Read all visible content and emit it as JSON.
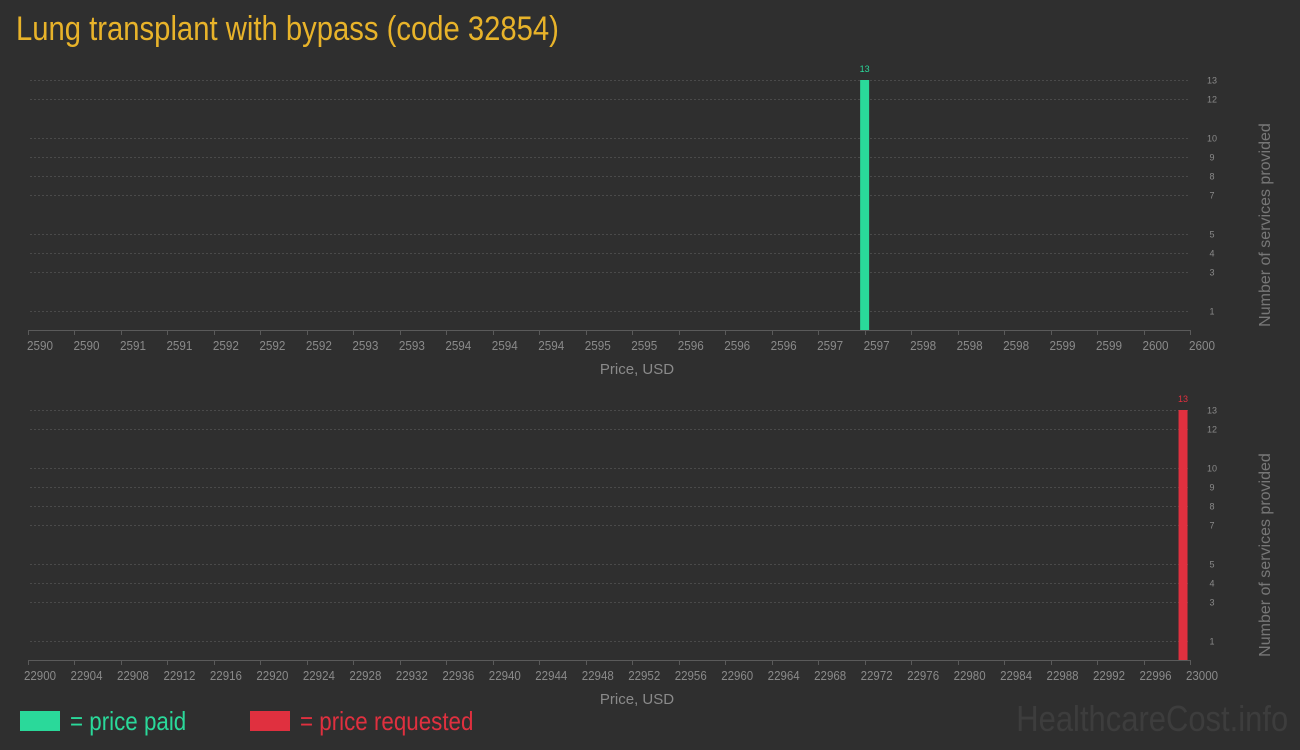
{
  "title": "Lung transplant with bypass (code 32854)",
  "colors": {
    "background": "#2f2f2f",
    "title": "#e8b32a",
    "paid": "#2ad99a",
    "requested": "#e0303f",
    "axis_text": "#8a8a8a",
    "grid": "#4a4a4a"
  },
  "legend": {
    "paid_label": "= price paid",
    "requested_label": "= price requested"
  },
  "watermark": "HealthcareCost.info",
  "chart_data": [
    {
      "type": "bar",
      "series_name": "price paid",
      "color": "#2ad99a",
      "xlabel": "Price, USD",
      "ylabel": "Number of services provided",
      "ylim": [
        0,
        13
      ],
      "yticks": [
        1,
        3,
        4,
        5,
        7,
        8,
        9,
        10,
        12,
        13
      ],
      "xticks": [
        "2590",
        "2590",
        "2591",
        "2591",
        "2592",
        "2592",
        "2592",
        "2593",
        "2593",
        "2594",
        "2594",
        "2594",
        "2595",
        "2595",
        "2596",
        "2596",
        "2596",
        "2597",
        "2597",
        "2598",
        "2598",
        "2598",
        "2599",
        "2599",
        "2600",
        "2600"
      ],
      "bars": [
        {
          "tick_index": 18,
          "value": 13,
          "label": "13"
        }
      ]
    },
    {
      "type": "bar",
      "series_name": "price requested",
      "color": "#e0303f",
      "xlabel": "Price, USD",
      "ylabel": "Number of services provided",
      "ylim": [
        0,
        13
      ],
      "yticks": [
        1,
        3,
        4,
        5,
        7,
        8,
        9,
        10,
        12,
        13
      ],
      "xticks": [
        "22900",
        "22904",
        "22908",
        "22912",
        "22916",
        "22920",
        "22924",
        "22928",
        "22932",
        "22936",
        "22940",
        "22944",
        "22948",
        "22952",
        "22956",
        "22960",
        "22964",
        "22968",
        "22972",
        "22976",
        "22980",
        "22984",
        "22988",
        "22992",
        "22996",
        "23000"
      ],
      "bars": [
        {
          "tick_index": 24.85,
          "value": 13,
          "label": "13"
        }
      ]
    }
  ]
}
